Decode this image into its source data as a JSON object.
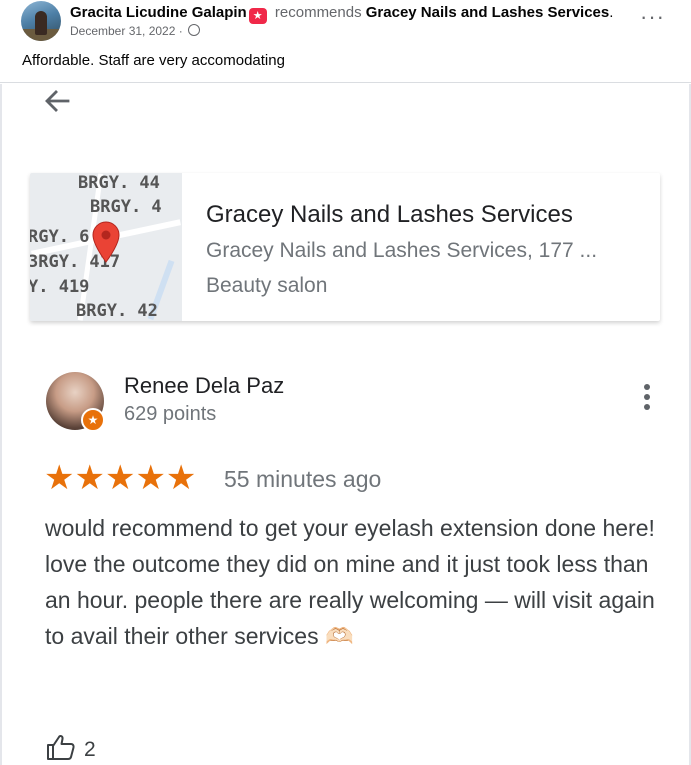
{
  "post": {
    "author": "Gracita Licudine Galapin",
    "action": "recommends",
    "business_link": "Gracey Nails and Lashes Services",
    "date": "December 31, 2022",
    "date_separator": "·",
    "caption": "Affordable. Staff are very accomodating"
  },
  "place_card": {
    "name": "Gracey Nails and Lashes Services",
    "address": "Gracey Nails and Lashes Services, 177 ...",
    "category": "Beauty salon",
    "map_labels": [
      "BRGY. 44",
      "BRGY. 4",
      "RGY. 6",
      "3RGY. 417",
      "Y. 419",
      "BRGY. 42"
    ]
  },
  "review": {
    "reviewer": "Renee Dela Paz",
    "points": "629 points",
    "stars_glyphs": "★★★★★",
    "rating": 5,
    "time": "55 minutes ago",
    "text": "would recommend to get your eyelash extension done here! love the outcome they did on mine and it just took less than an hour. people there are really welcoming — will visit again to avail their other services 🫶🏻",
    "likes": "2"
  },
  "colors": {
    "accent_star": "#e8710a",
    "map_pin": "#ea4335",
    "badge": "#f02849"
  }
}
